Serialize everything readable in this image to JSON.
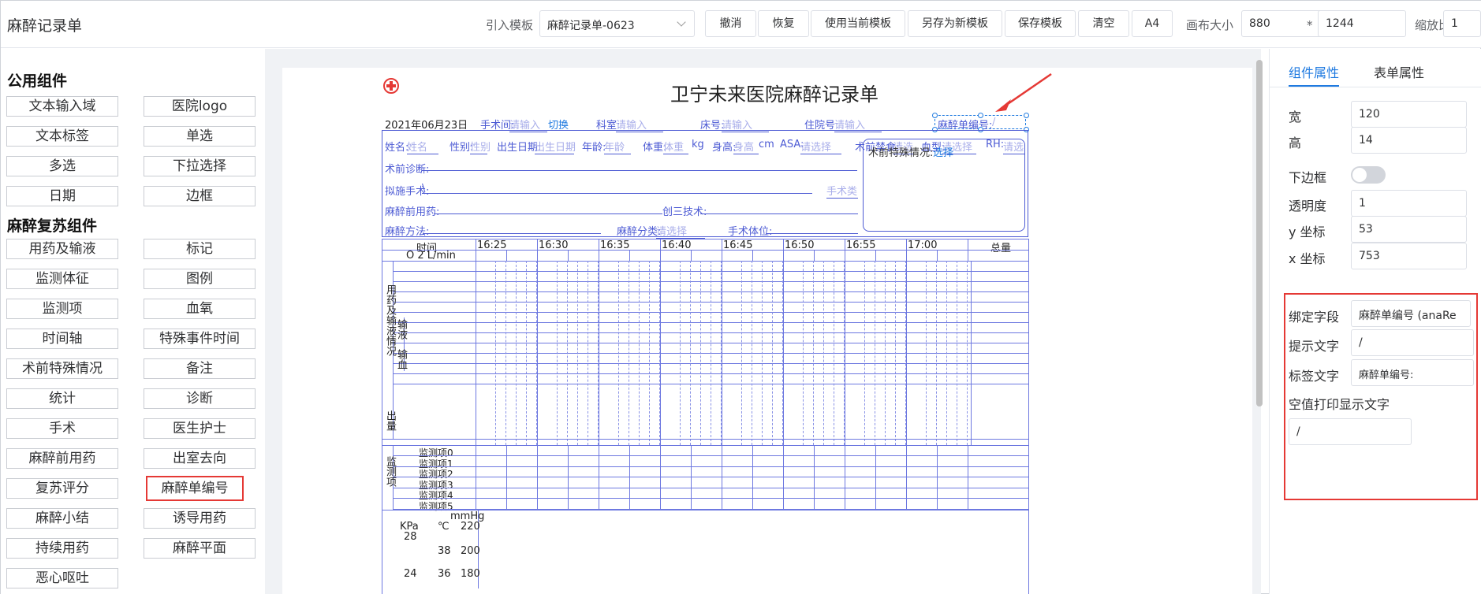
{
  "app": {
    "title": "麻醉记录单"
  },
  "toolbar": {
    "template_label": "引入模板",
    "template_value": "麻醉记录单-0623",
    "undo": "撤消",
    "redo": "恢复",
    "use_template": "使用当前模板",
    "save_as_new": "另存为新模板",
    "save_template": "保存模板",
    "clear": "清空",
    "a4": "A4",
    "canvas_size_label": "画布大小",
    "canvas_width": "880",
    "times": "*",
    "canvas_height": "1244",
    "zoom_label": "缩放比例",
    "zoom_value": "1"
  },
  "sidebar": {
    "group_public": "公用组件",
    "public_items": [
      "文本输入域",
      "医院logo",
      "文本标签",
      "单选",
      "多选",
      "下拉选择",
      "日期",
      "边框"
    ],
    "group_anesthesia": "麻醉复苏组件",
    "anesthesia_items": [
      "用药及输液",
      "标记",
      "监测体征",
      "图例",
      "监测项",
      "血氧",
      "时间轴",
      "特殊事件时间",
      "术前特殊情况",
      "备注",
      "统计",
      "诊断",
      "手术",
      "医生护士",
      "麻醉前用药",
      "出室去向",
      "复苏评分",
      "麻醉单编号",
      "麻醉小结",
      "诱导用药",
      "持续用药",
      "麻醉平面",
      "恶心呕吐"
    ]
  },
  "paper": {
    "hospital_title": "卫宁未来医院麻醉记录单",
    "date": "2021年06月23日",
    "surgery_room_label": "手术间:",
    "surgery_room_ph": "请输入",
    "switch": "切换",
    "dept_label": "科室:",
    "dept_ph": "请输入",
    "bed_label": "床号:",
    "bed_ph": "请输入",
    "inpatient_label": "住院号:",
    "inpatient_ph": "请输入",
    "ana_no_label": "麻醉单编号:",
    "ana_no_value": "/",
    "name_label": "姓名:",
    "name_ph": "姓名",
    "sex_label": "性别:",
    "sex_ph": "性别",
    "birth_label": "出生日期:",
    "birth_ph": "出生日期",
    "age_label": "年龄:",
    "age_ph": "年龄",
    "weight_label": "体重:",
    "weight_ph": "体重",
    "weight_unit": "kg",
    "height_label": "身高:",
    "height_ph": "身高",
    "height_unit": "cm",
    "asa_label": "ASA:",
    "asa_ph": "请选择",
    "fasting_label": "术前禁食:",
    "fasting_ph": "请选",
    "blood_label": "血型:",
    "blood_ph": "请选择",
    "rh_label": "RH:",
    "rh_ph": "请选",
    "pre_diag_label": "术前诊断:",
    "planned_op_label": "拟施手术:",
    "planned_op_value": "\\",
    "op_type_ph": "手术类",
    "special_label": "术前特殊情况:",
    "special_link": "选择",
    "pre_med_label": "麻醉前用药:",
    "invasive_label": "创三技术:",
    "method_label": "麻醉方法:",
    "category_label": "麻醉分类:",
    "category_ph": "请选择",
    "position_label": "手术体位:",
    "time_label": "时间",
    "o2_label": "O 2 L/min",
    "times": [
      "16:25",
      "16:30",
      "16:35",
      "16:40",
      "16:45",
      "16:50",
      "16:55",
      "17:00"
    ],
    "total_label": "总量",
    "drug_section": "用药及输液情况",
    "infusion_label": "输液",
    "transfusion_label": "输血",
    "output_label": "出量",
    "monitor_section": "监测项",
    "monitor_items": [
      "监测项0",
      "监测项1",
      "监测项2",
      "监测项3",
      "监测项4",
      "监测项5"
    ],
    "mmhg": "mmHg",
    "kpa": "KPa",
    "celsius": "℃",
    "axis_row1": [
      "28",
      "",
      "220"
    ],
    "axis_row2": [
      "",
      "38",
      "200"
    ],
    "axis_row3": [
      "24",
      "36",
      "180"
    ]
  },
  "right_panel": {
    "tab_component": "组件属性",
    "tab_form": "表单属性",
    "width_label": "宽",
    "width_value": "120",
    "height_label": "高",
    "height_value": "14",
    "bottom_border_label": "下边框",
    "opacity_label": "透明度",
    "opacity_value": "1",
    "y_label": "y 坐标",
    "y_value": "53",
    "x_label": "x 坐标",
    "x_value": "753",
    "bind_field_label": "绑定字段",
    "bind_field_value": "麻醉单编号 (anaRe",
    "hint_label": "提示文字",
    "hint_value": "/",
    "tag_label": "标签文字",
    "tag_value": "麻醉单编号:",
    "empty_print_label": "空值打印显示文字",
    "empty_print_value": "/"
  },
  "colors": {
    "accent": "#1f7ae0",
    "form_blue": "#4d5bd4",
    "highlight_red": "#e53935"
  }
}
